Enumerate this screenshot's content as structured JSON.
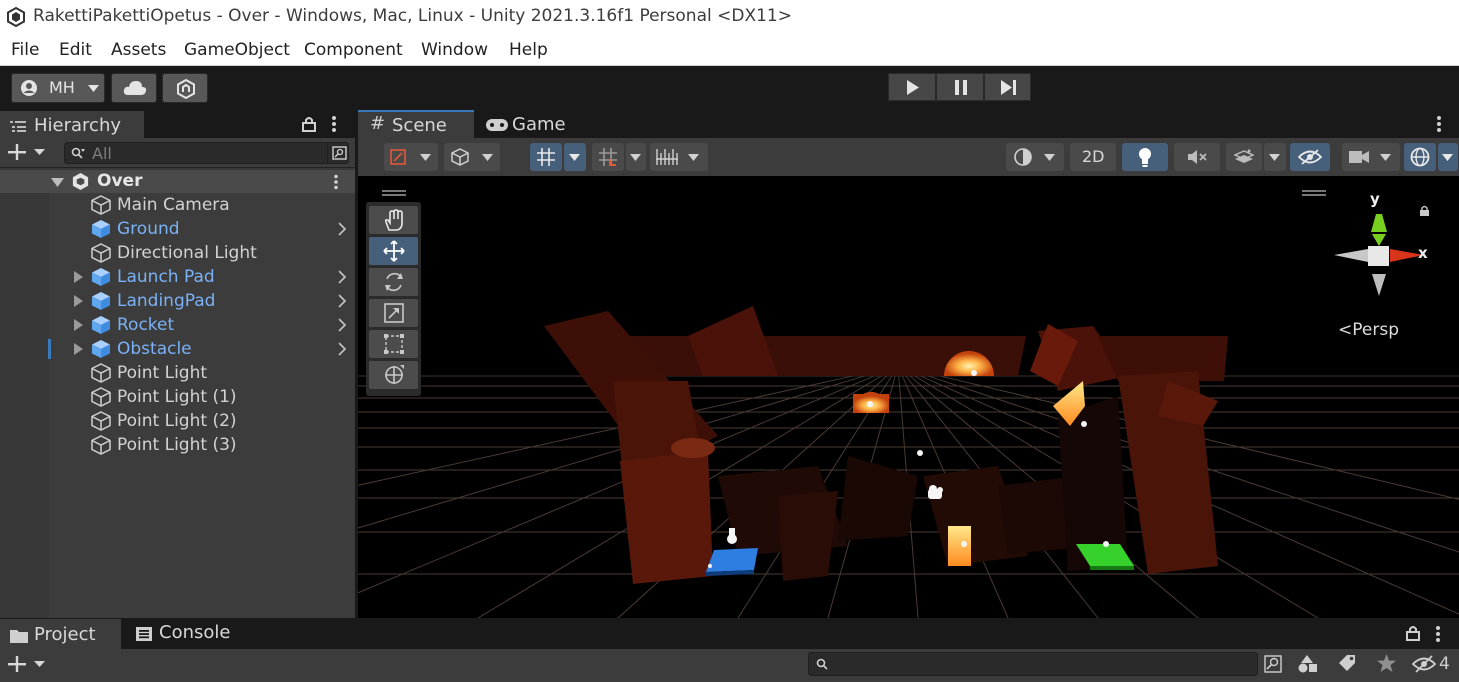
{
  "window": {
    "title": "RakettiPakettiOpetus - Over - Windows, Mac, Linux - Unity 2021.3.16f1 Personal <DX11>"
  },
  "menu": [
    "File",
    "Edit",
    "Assets",
    "GameObject",
    "Component",
    "Window",
    "Help"
  ],
  "toolbar": {
    "account_label": "MH",
    "icons": [
      "account-icon",
      "cloud-icon",
      "collab-icon",
      "play-icon",
      "pause-icon",
      "step-icon"
    ]
  },
  "hierarchy": {
    "tab_label": "Hierarchy",
    "search_placeholder": "All",
    "scene_name": "Over",
    "items": [
      {
        "label": "Main Camera",
        "prefab": false,
        "expandable": false
      },
      {
        "label": "Ground",
        "prefab": true,
        "expandable": false
      },
      {
        "label": "Directional Light",
        "prefab": false,
        "expandable": false
      },
      {
        "label": "Launch Pad",
        "prefab": true,
        "expandable": true
      },
      {
        "label": "LandingPad",
        "prefab": true,
        "expandable": true
      },
      {
        "label": "Rocket",
        "prefab": true,
        "expandable": true
      },
      {
        "label": "Obstacle",
        "prefab": true,
        "expandable": true
      },
      {
        "label": "Point Light",
        "prefab": false,
        "expandable": false
      },
      {
        "label": "Point Light (1)",
        "prefab": false,
        "expandable": false
      },
      {
        "label": "Point Light (2)",
        "prefab": false,
        "expandable": false
      },
      {
        "label": "Point Light (3)",
        "prefab": false,
        "expandable": false
      }
    ]
  },
  "scene_view": {
    "tabs": [
      "Scene",
      "Game"
    ],
    "active_tab": "Scene",
    "toggle_2d_label": "2D",
    "gizmo": {
      "x_label": "x",
      "y_label": "y",
      "projection_label": "Persp"
    }
  },
  "bottom": {
    "tabs": [
      "Project",
      "Console"
    ],
    "active_tab": "Project",
    "hidden_count": "4"
  },
  "colors": {
    "prefab_blue": "#7bb1f5",
    "selected_tab_accent": "#3a79bb",
    "gizmo_x": "#d8341b",
    "gizmo_y": "#77d020"
  }
}
